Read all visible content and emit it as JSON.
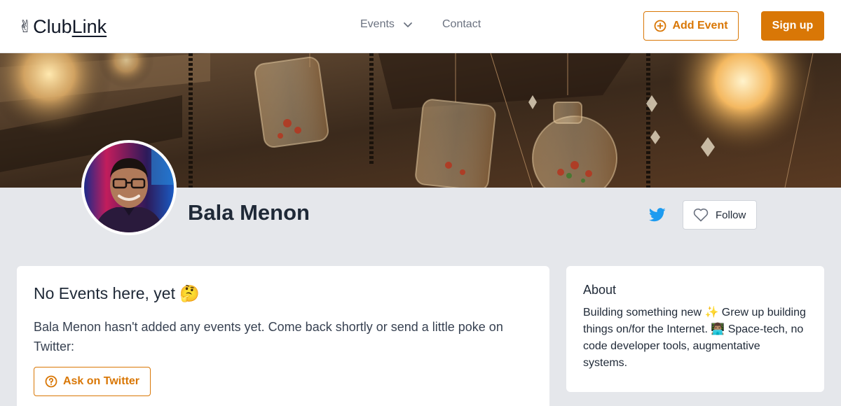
{
  "header": {
    "logo_prefix": "Club",
    "logo_suffix": "Link",
    "logo_emoji": "✌",
    "nav": {
      "events_label": "Events",
      "contact_label": "Contact"
    },
    "add_event_label": "Add Event",
    "signup_label": "Sign up"
  },
  "profile": {
    "name": "Bala Menon",
    "follow_label": "Follow"
  },
  "events_card": {
    "title": "No Events here, yet 🤔",
    "message": "Bala Menon hasn't added any events yet. Come back shortly or send a little poke on Twitter:",
    "ask_label": "Ask on Twitter"
  },
  "about_card": {
    "title": "About",
    "bio": "Building something new ✨ Grew up building things on/for the Internet. 👨🏽‍💻 Space-tech, no code developer tools, augmentative systems."
  },
  "colors": {
    "accent": "#d97706",
    "twitter": "#1d9bf0",
    "page_bg": "#e5e7eb"
  },
  "icons": [
    "chevron-down-icon",
    "plus-circle-icon",
    "twitter-icon",
    "heart-icon",
    "question-circle-icon"
  ]
}
